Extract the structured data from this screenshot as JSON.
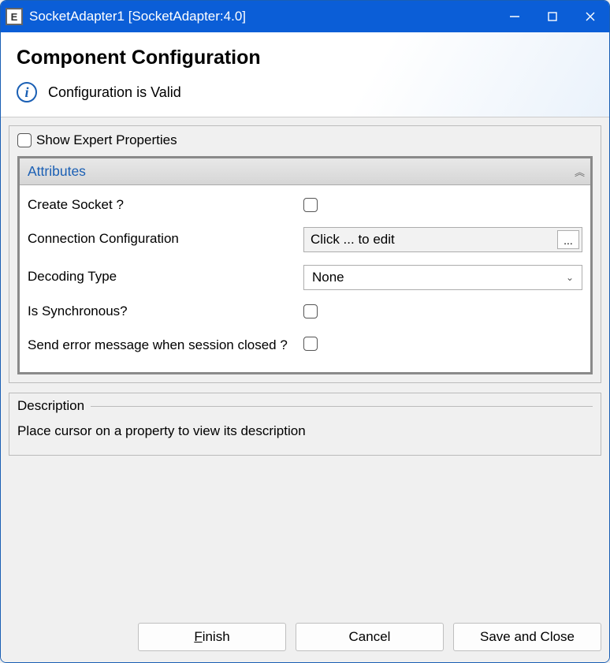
{
  "window": {
    "icon_letter": "E",
    "title": "SocketAdapter1 [SocketAdapter:4.0]"
  },
  "header": {
    "title": "Component Configuration",
    "status": "Configuration is Valid"
  },
  "expert_checkbox_label": "Show Expert Properties",
  "attributes": {
    "section_title": "Attributes",
    "rows": {
      "create_socket": {
        "label": "Create Socket ?"
      },
      "connection_config": {
        "label": "Connection Configuration",
        "value": "Click ... to edit",
        "button": "..."
      },
      "decoding_type": {
        "label": "Decoding Type",
        "value": "None"
      },
      "is_synchronous": {
        "label": "Is Synchronous?"
      },
      "send_error": {
        "label": "Send error message when session closed ?"
      }
    }
  },
  "description": {
    "title": "Description",
    "body": "Place cursor on a property to view its description"
  },
  "buttons": {
    "finish_pre": "F",
    "finish_rest": "inish",
    "cancel": "Cancel",
    "save_close": "Save and Close"
  }
}
